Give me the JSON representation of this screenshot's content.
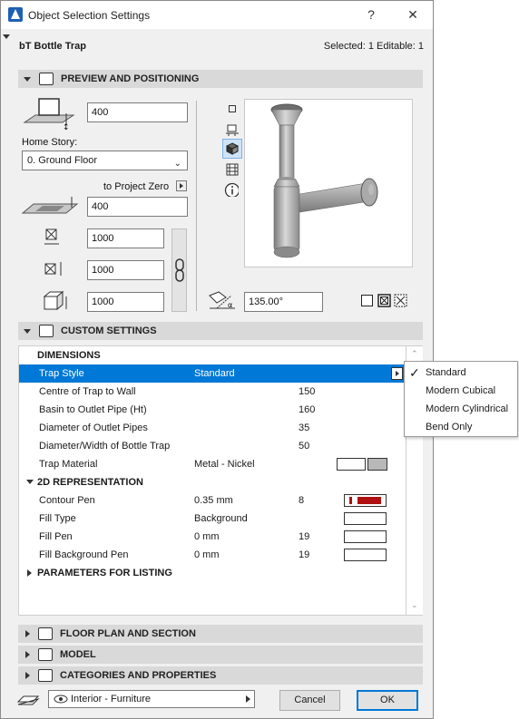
{
  "window": {
    "title": "Object Selection Settings",
    "help": "?",
    "close": "✕"
  },
  "object_name": "bT Bottle Trap",
  "selection_info": "Selected: 1 Editable: 1",
  "preview_section": {
    "title": "PREVIEW AND POSITIONING",
    "elevation_value": "400",
    "home_story_label": "Home Story:",
    "home_story_value": "0. Ground Floor",
    "project_zero_label": "to Project Zero",
    "project_zero_value": "400",
    "dim_x_value": "1000",
    "dim_y_value": "1000",
    "dim_z_value": "1000",
    "angle_value": "135.00°"
  },
  "custom_section": {
    "title": "CUSTOM SETTINGS",
    "dimensions_group": "DIMENSIONS",
    "rows": [
      {
        "name": "Trap Style",
        "value": "Standard",
        "num": ""
      },
      {
        "name": "Centre of Trap to Wall",
        "value": "",
        "num": "150"
      },
      {
        "name": "Basin to Outlet Pipe (Ht)",
        "value": "",
        "num": "160"
      },
      {
        "name": "Diameter of Outlet Pipes",
        "value": "",
        "num": "35"
      },
      {
        "name": "Diameter/Width of Bottle Trap",
        "value": "",
        "num": "50"
      },
      {
        "name": "Trap Material",
        "value": "Metal - Nickel",
        "num": ""
      }
    ],
    "rep_group": "2D REPRESENTATION",
    "rep_rows": [
      {
        "name": "Contour Pen",
        "value": "0.35 mm",
        "num": "8"
      },
      {
        "name": "Fill Type",
        "value": "Background",
        "num": ""
      },
      {
        "name": "Fill Pen",
        "value": "0 mm",
        "num": "19"
      },
      {
        "name": "Fill Background Pen",
        "value": "0 mm",
        "num": "19"
      }
    ],
    "listing_group": "PARAMETERS FOR LISTING"
  },
  "trap_style_options": [
    "Standard",
    "Modern Cubical",
    "Modern Cylindrical",
    "Bend Only"
  ],
  "trap_style_selected": "Standard",
  "collapsed_sections": [
    "FLOOR PLAN AND SECTION",
    "MODEL",
    "CATEGORIES AND PROPERTIES"
  ],
  "footer": {
    "layer_value": "Interior - Furniture",
    "cancel_label": "Cancel",
    "ok_label": "OK"
  },
  "colors": {
    "accent": "#0078d7",
    "contour_pen": "#b01010",
    "header_bg": "#d9d9d9"
  }
}
